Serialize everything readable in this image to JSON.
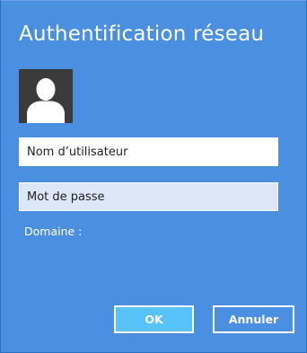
{
  "dialog": {
    "title": "Authentification réseau",
    "avatar_icon": "user-silhouette-icon",
    "username": {
      "placeholder": "Nom d’utilisateur",
      "value": ""
    },
    "password": {
      "placeholder": "Mot de passe",
      "value": ""
    },
    "domain_label": "Domaine :",
    "ok_label": "OK",
    "cancel_label": "Annuler"
  },
  "colors": {
    "background": "#4b8fe0",
    "ok_button": "#56c3fb",
    "avatar_background": "#3b3b3b",
    "text": "#ffffff"
  }
}
